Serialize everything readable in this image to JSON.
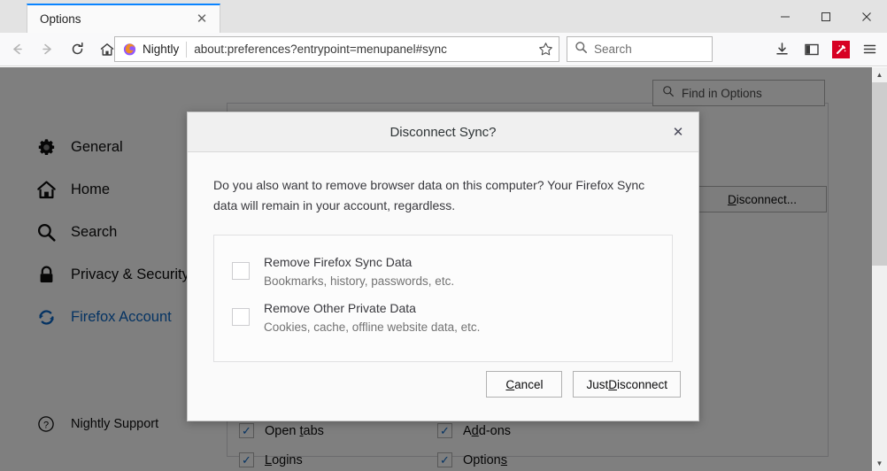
{
  "window": {
    "controls": {
      "minimize": "minimize-icon",
      "maximize": "maximize-icon",
      "close": "close-icon"
    }
  },
  "tab": {
    "title": "Options",
    "close_label": "✕"
  },
  "toolbar": {
    "back_icon": "back-arrow-icon",
    "forward_icon": "forward-arrow-icon",
    "reload_icon": "reload-icon",
    "home_icon": "home-icon",
    "brand_label": "Nightly",
    "url": "about:preferences?entrypoint=menupanel#sync",
    "bookmark_icon": "star-icon",
    "search_placeholder": "Search",
    "downloads_icon": "download-icon",
    "sidebar_icon": "sidebar-icon",
    "wand_icon": "wand-icon",
    "menu_icon": "hamburger-menu-icon",
    "wand_color": "#d70022",
    "tab_accent_color": "#0a84ff"
  },
  "page": {
    "find": {
      "placeholder": "Find in Options",
      "icon": "search-icon"
    },
    "sidebar": {
      "items": [
        {
          "label": "General",
          "icon": "gear-icon",
          "active": false
        },
        {
          "label": "Home",
          "icon": "home-icon",
          "active": false
        },
        {
          "label": "Search",
          "icon": "search-icon",
          "active": false
        },
        {
          "label": "Privacy & Security",
          "icon": "lock-icon",
          "active": false
        },
        {
          "label": "Firefox Account",
          "icon": "sync-icon",
          "active": true
        }
      ],
      "support": {
        "label": "Nightly Support",
        "icon": "question-circle-icon"
      },
      "active_color": "#0a67c6"
    },
    "disconnect_button": {
      "prefix": "",
      "accesskey": "D",
      "rest": "isconnect..."
    },
    "engines": [
      {
        "label_prefix": "Open ",
        "accesskey": "t",
        "label_rest": "abs",
        "checked": true
      },
      {
        "label_prefix": "A",
        "accesskey": "d",
        "label_rest": "d-ons",
        "checked": true
      },
      {
        "label_prefix": "",
        "accesskey": "L",
        "label_rest": "ogins",
        "checked": true
      },
      {
        "label_prefix": "Option",
        "accesskey": "s",
        "label_rest": "",
        "checked": true
      }
    ],
    "check_mark": "✓"
  },
  "dialog": {
    "title": "Disconnect Sync?",
    "close_label": "✕",
    "message": "Do you also want to remove browser data on this computer? Your Firefox Sync data will remain in your account, regardless.",
    "options": [
      {
        "title": "Remove Firefox Sync Data",
        "subtitle": "Bookmarks, history, passwords, etc.",
        "checked": false
      },
      {
        "title": "Remove Other Private Data",
        "subtitle": "Cookies, cache, offline website data, etc.",
        "checked": false
      }
    ],
    "buttons": {
      "cancel": {
        "accesskey": "C",
        "rest": "ancel",
        "prefix": ""
      },
      "confirm": {
        "prefix": "Just ",
        "accesskey": "D",
        "rest": "isconnect"
      }
    }
  },
  "scrollbar": {
    "up": "▲",
    "down": "▼"
  }
}
